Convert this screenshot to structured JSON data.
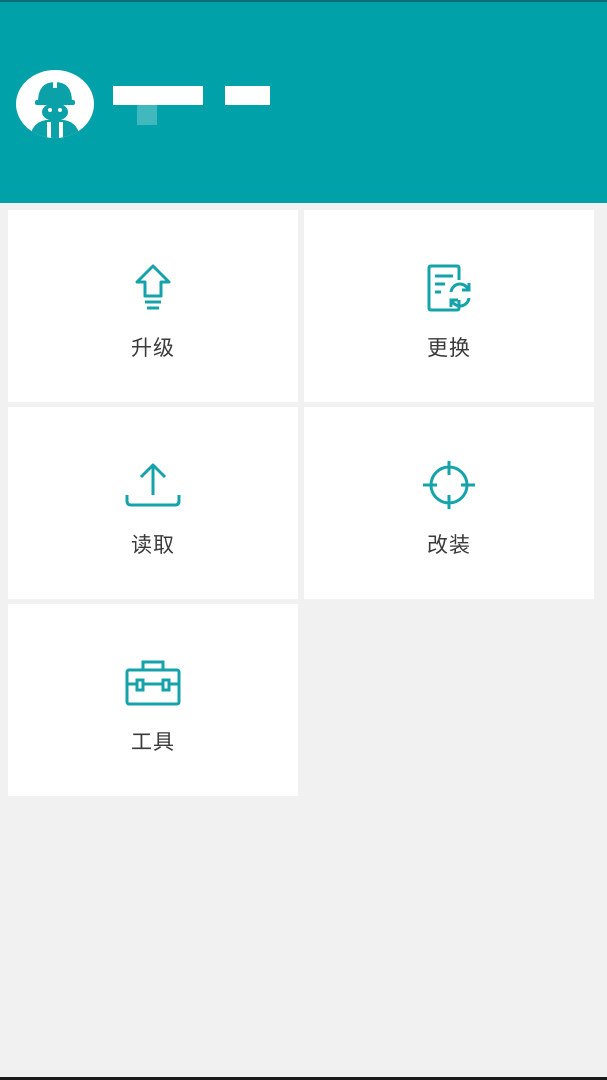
{
  "theme": {
    "accent": "#01a1a9",
    "background": "#f1f1f1",
    "tile_background": "#ffffff",
    "label_color": "#3a3a3a"
  },
  "header": {
    "avatar_icon": "worker-helmet-avatar",
    "user_name": "",
    "user_role": ""
  },
  "menu": {
    "items": [
      {
        "label": "升级",
        "icon": "upgrade-arrow-icon"
      },
      {
        "label": "更换",
        "icon": "replace-document-icon"
      },
      {
        "label": "读取",
        "icon": "read-upload-icon"
      },
      {
        "label": "改装",
        "icon": "target-crosshair-icon"
      },
      {
        "label": "工具",
        "icon": "toolbox-icon"
      }
    ]
  }
}
